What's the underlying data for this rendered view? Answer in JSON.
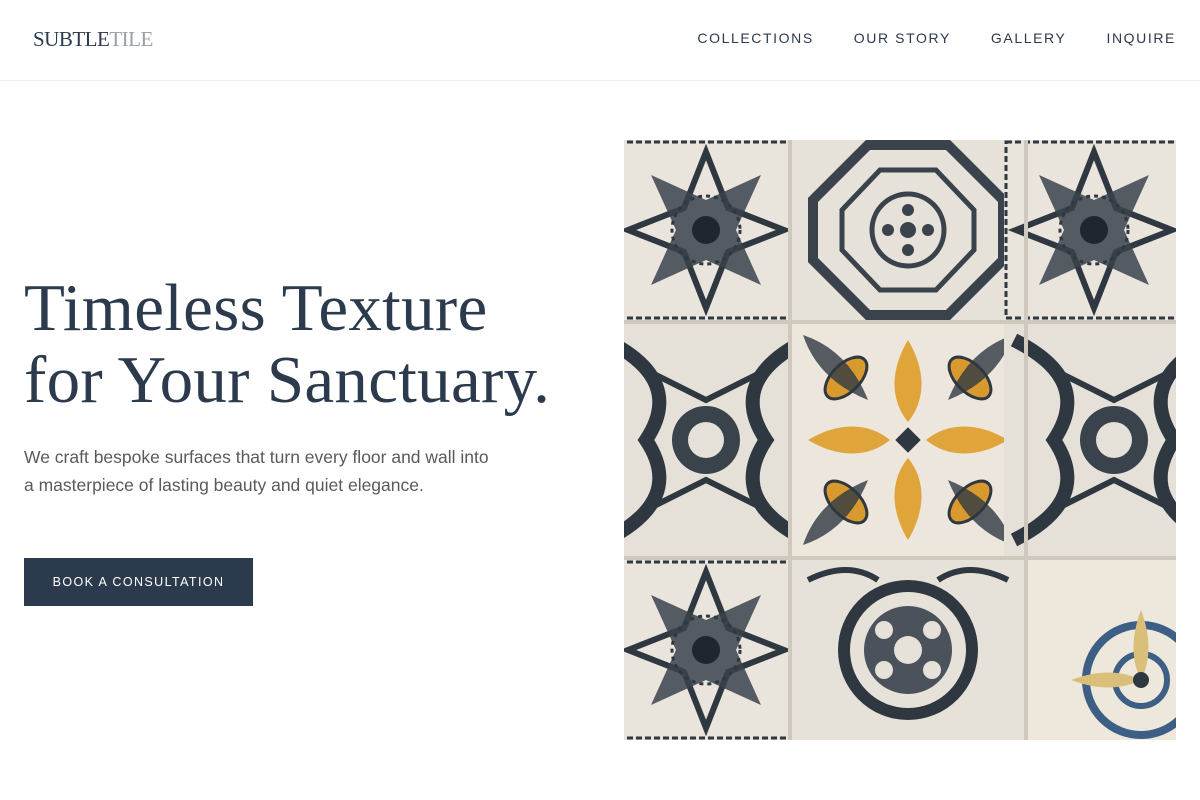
{
  "brand": {
    "part1": "SUBTLE",
    "part2": "TILE"
  },
  "nav": [
    {
      "label": "COLLECTIONS"
    },
    {
      "label": "OUR STORY"
    },
    {
      "label": "GALLERY"
    },
    {
      "label": "INQUIRE"
    }
  ],
  "hero": {
    "headline_line1": "Timeless Texture",
    "headline_line2": "for Your Sanctuary.",
    "subtext": "We craft bespoke surfaces that turn every floor and wall into a masterpiece of lasting beauty and quiet elegance.",
    "cta_label": "BOOK A CONSULTATION",
    "image_alt": "decorative-tile-mosaic-image"
  },
  "colors": {
    "primary": "#2c3a4d",
    "logo_accent": "#9aa0a6",
    "body_text": "#5a5a5a",
    "tile_ochre": "#e0a53a",
    "tile_ink": "#2f3841",
    "tile_ground": "#e9e4dc"
  }
}
